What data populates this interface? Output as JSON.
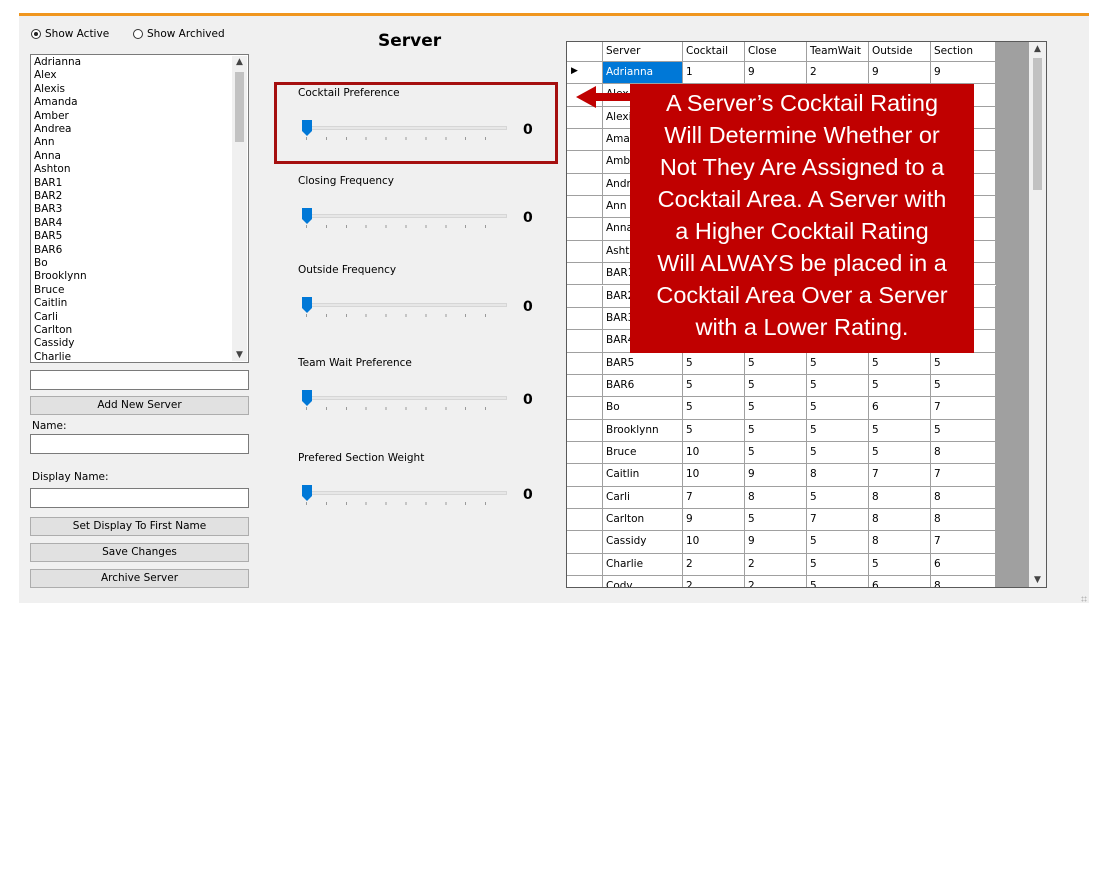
{
  "filters": {
    "active_label": "Show Active",
    "archived_label": "Show Archived",
    "selected": "active"
  },
  "server_list": [
    "Adrianna",
    "Alex",
    "Alexis",
    "Amanda",
    "Amber",
    "Andrea",
    "Ann",
    "Anna",
    "Ashton",
    "BAR1",
    "BAR2",
    "BAR3",
    "BAR4",
    "BAR5",
    "BAR6",
    "Bo",
    "Brooklynn",
    "Bruce",
    "Caitlin",
    "Carli",
    "Carlton",
    "Cassidy",
    "Charlie"
  ],
  "form": {
    "new_server_value": "",
    "add_button": "Add New Server",
    "name_label": "Name:",
    "name_value": "",
    "display_name_label": "Display Name:",
    "display_name_value": "",
    "set_display_button": "Set Display To First Name",
    "save_button": "Save Changes",
    "archive_button": "Archive Server"
  },
  "title": "Server",
  "sliders": [
    {
      "label": "Cocktail Preference",
      "value": "0"
    },
    {
      "label": "Closing Frequency",
      "value": "0"
    },
    {
      "label": "Outside Frequency",
      "value": "0"
    },
    {
      "label": "Team Wait Preference",
      "value": "0"
    },
    {
      "label": "Prefered Section Weight",
      "value": "0"
    }
  ],
  "grid": {
    "columns": [
      "Server",
      "Cocktail",
      "Close",
      "TeamWait",
      "Outside",
      "Section"
    ],
    "rows": [
      [
        "Adrianna",
        "1",
        "9",
        "2",
        "9",
        "9"
      ],
      [
        "Alex",
        "",
        "",
        "",
        "",
        ""
      ],
      [
        "Alexis",
        "",
        "",
        "",
        "",
        ""
      ],
      [
        "Amanda",
        "",
        "",
        "",
        "",
        ""
      ],
      [
        "Amber",
        "",
        "",
        "",
        "",
        ""
      ],
      [
        "Andrea",
        "",
        "",
        "",
        "",
        ""
      ],
      [
        "Ann",
        "",
        "",
        "",
        "",
        ""
      ],
      [
        "Anna",
        "",
        "",
        "",
        "",
        ""
      ],
      [
        "Ashton",
        "",
        "",
        "",
        "",
        ""
      ],
      [
        "BAR1",
        "",
        "",
        "",
        "",
        ""
      ],
      [
        "BAR2",
        "",
        "",
        "",
        "",
        ""
      ],
      [
        "BAR3",
        "",
        "",
        "",
        "",
        ""
      ],
      [
        "BAR4",
        "",
        "",
        "",
        "",
        ""
      ],
      [
        "BAR5",
        "5",
        "5",
        "5",
        "5",
        "5"
      ],
      [
        "BAR6",
        "5",
        "5",
        "5",
        "5",
        "5"
      ],
      [
        "Bo",
        "5",
        "5",
        "5",
        "6",
        "7"
      ],
      [
        "Brooklynn",
        "5",
        "5",
        "5",
        "5",
        "5"
      ],
      [
        "Bruce",
        "10",
        "5",
        "5",
        "5",
        "8"
      ],
      [
        "Caitlin",
        "10",
        "9",
        "8",
        "7",
        "7"
      ],
      [
        "Carli",
        "7",
        "8",
        "5",
        "8",
        "8"
      ],
      [
        "Carlton",
        "9",
        "5",
        "7",
        "8",
        "8"
      ],
      [
        "Cassidy",
        "10",
        "9",
        "5",
        "8",
        "7"
      ],
      [
        "Charlie",
        "2",
        "2",
        "5",
        "5",
        "6"
      ],
      [
        "Cody",
        "2",
        "2",
        "5",
        "6",
        "8"
      ]
    ],
    "selected_row": 0
  },
  "callout": {
    "lines": [
      "A Server’s Cocktail Rating",
      "Will Determine Whether or",
      "Not They Are Assigned to a",
      "Cocktail Area. A Server with",
      "a Higher Cocktail Rating",
      "Will ALWAYS be placed in a",
      "Cocktail Area Over a Server",
      "with a Lower Rating."
    ],
    "color": "#c00000"
  },
  "accent_color": "#f0961e"
}
